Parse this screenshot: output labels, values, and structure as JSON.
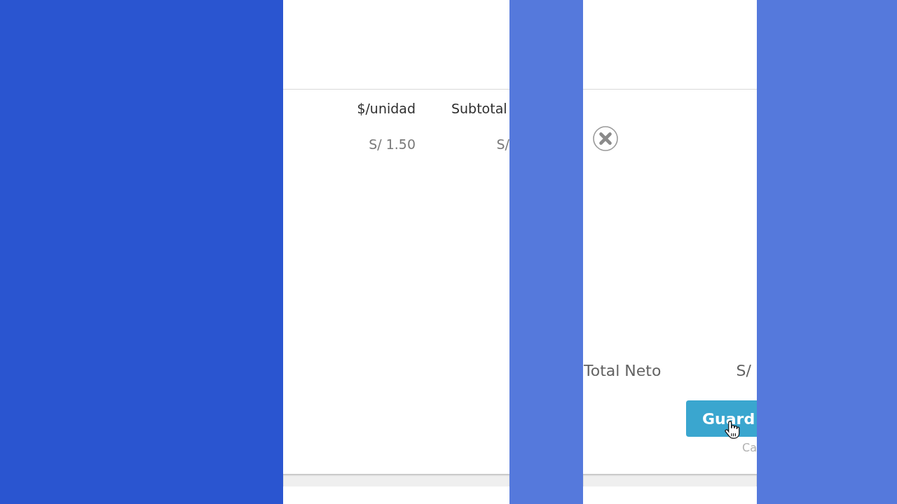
{
  "table": {
    "columns": [
      "$/unidad",
      "Subtotal"
    ],
    "rows": [
      [
        "S/ 1.50",
        "S/"
      ]
    ]
  },
  "totals": [
    {
      "label": "Total Neto",
      "value": "S/"
    }
  ],
  "actions": [
    {
      "kind": "primary",
      "label": "Guard"
    },
    {
      "kind": "link",
      "label": "Ca"
    }
  ]
}
